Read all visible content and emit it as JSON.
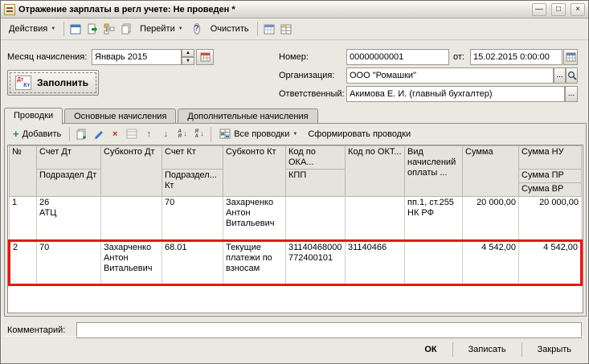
{
  "colors": {
    "highlight_border": "#e01b14",
    "accent_blue": "#2b5fb4",
    "accent_green": "#1f8f35",
    "accent_red": "#c3291d"
  },
  "window": {
    "title": "Отражение зарплаты в регл учете: Не проведен *",
    "controls": {
      "minimize": "—",
      "maximize": "□",
      "close": "×"
    }
  },
  "toolbar": {
    "actions_label": "Действия",
    "goto_label": "Перейти",
    "clear_label": "Очистить"
  },
  "icons": {
    "caret": "▼",
    "spin_up": "▲",
    "spin_down": "▼",
    "plus": "+",
    "cross": "×",
    "arrow_up": "↑",
    "arrow_down": "↓",
    "sort_asc_top": "А",
    "sort_asc_bottom": "Я",
    "sort_desc_top": "Я",
    "sort_desc_bottom": "А",
    "sort_arrow": "↓",
    "help": "?",
    "ellipsis": "...",
    "dt": "Дт",
    "kt": "Кт"
  },
  "form": {
    "month": {
      "label": "Месяц начисления:",
      "value": "Январь 2015"
    },
    "number": {
      "label": "Номер:",
      "value": "00000000001"
    },
    "date": {
      "label": "от:",
      "value": "15.02.2015 0:00:00"
    },
    "organization": {
      "label": "Организация:",
      "value": "ООО \"Ромашки\""
    },
    "responsible": {
      "label": "Ответственный:",
      "value": "Акимова Е. И. (главный бухгалтер)"
    },
    "fill_button_label": "Заполнить"
  },
  "tabs": [
    {
      "label": "Проводки"
    },
    {
      "label": "Основные начисления"
    },
    {
      "label": "Дополнительные начисления"
    }
  ],
  "grid_toolbar": {
    "add_label": "Добавить",
    "all_postings_label": "Все проводки",
    "generate_label": "Сформировать проводки"
  },
  "grid": {
    "headers": {
      "num": "№",
      "debit_account": "Счет Дт",
      "debit_subdivision": "Подраздел Дт",
      "debit_subconto": "Субконто Дт",
      "credit_account": "Счет Кт",
      "credit_subdivision": "Подраздел... Кт",
      "credit_subconto": "Субконто Кт",
      "okato": "Код по ОКА...",
      "kpp": "КПП",
      "oktmo": "Код по ОКТ...",
      "accrual_type": "Вид начислений оплаты ...",
      "amount": "Сумма",
      "amount_nu": "Сумма НУ",
      "amount_pr": "Сумма ПР",
      "amount_vr": "Сумма ВР"
    },
    "rows": [
      {
        "num": "1",
        "debit_account": "26",
        "debit_subdivision": "АТЦ",
        "debit_subconto": "",
        "credit_account": "70",
        "credit_subdivision": "",
        "credit_subconto": "Захарченко Антон Витальевич",
        "okato": "",
        "kpp": "",
        "oktmo": "",
        "accrual_type": "пп.1, ст.255 НК РФ",
        "amount": "20 000,00",
        "amount_nu": "20 000,00"
      },
      {
        "num": "2",
        "debit_account": "70",
        "debit_subdivision": "",
        "debit_subconto": "Захарченко Антон Витальевич",
        "credit_account": "68.01",
        "credit_subdivision": "",
        "credit_subconto": "Текущие платежи по взносам",
        "okato": "31140468000",
        "kpp": "772400101",
        "oktmo": "31140466",
        "accrual_type": "",
        "amount": "4 542,00",
        "amount_nu": "4 542,00"
      }
    ]
  },
  "comment": {
    "label": "Комментарий:",
    "value": ""
  },
  "footer": {
    "ok_label": "ОК",
    "save_label": "Записать",
    "close_label": "Закрыть"
  }
}
